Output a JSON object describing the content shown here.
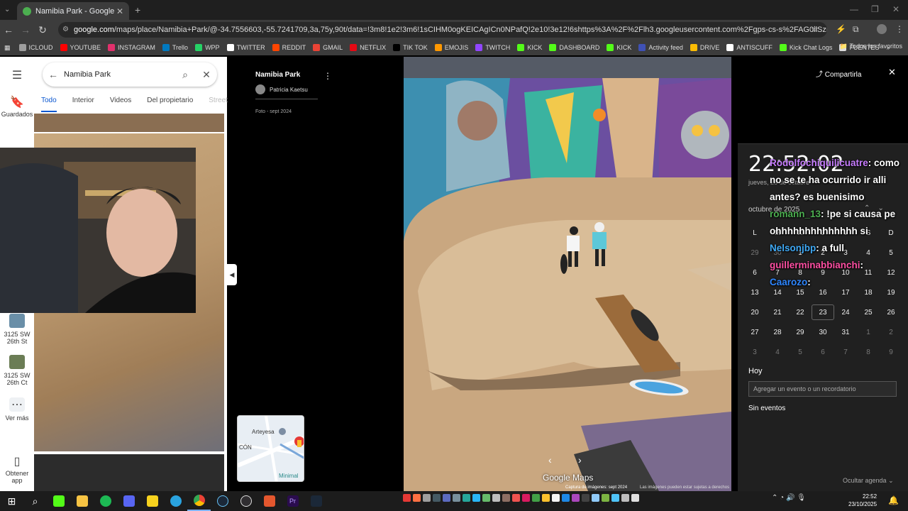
{
  "browser": {
    "tab_title": "Namibia Park - Google Maps",
    "url_host": "google.com",
    "url_rest": "/maps/place/Namibia+Park/@-34.7556603,-55.7241709,3a,75y,90t/data=!3m8!1e2!3m6!1sCIHM0ogKEICAgICn0NPafQ!2e10!3e12!6shttps%3A%2F%2Flh3.googleusercontent.com%2Fgps-cs-s%2FAG0ilSzLO_45bIbOw9xZqQwe5sg_tLDGi9...",
    "bookmarks": [
      {
        "label": "ICLOUD",
        "color": "#9e9e9e"
      },
      {
        "label": "YOUTUBE",
        "color": "#ff0000"
      },
      {
        "label": "INSTAGRAM",
        "color": "#e1306c"
      },
      {
        "label": "Trello",
        "color": "#0079bf"
      },
      {
        "label": "WPP",
        "color": "#25d366"
      },
      {
        "label": "TWITTER",
        "color": "#ffffff"
      },
      {
        "label": "REDDIT",
        "color": "#ff4500"
      },
      {
        "label": "GMAIL",
        "color": "#ea4335"
      },
      {
        "label": "NETFLIX",
        "color": "#e50914"
      },
      {
        "label": "TIK TOK",
        "color": "#000000"
      },
      {
        "label": "EMOJIS",
        "color": "#ff9800"
      },
      {
        "label": "TWITCH",
        "color": "#9146ff"
      },
      {
        "label": "KICK",
        "color": "#53fc18"
      },
      {
        "label": "DASHBOARD",
        "color": "#53fc18"
      },
      {
        "label": "KICK",
        "color": "#53fc18"
      },
      {
        "label": "Activity feed",
        "color": "#3f51b5"
      },
      {
        "label": "DRIVE",
        "color": "#fbbc04"
      },
      {
        "label": "ANTISCUFF",
        "color": "#ffffff"
      },
      {
        "label": "Kick Chat Logs",
        "color": "#53fc18"
      },
      {
        "label": "FUENTES",
        "color": "#dddddd"
      }
    ],
    "bookmarks_more": "»",
    "all_bookmarks": "Todos los favoritos"
  },
  "maps": {
    "rail": {
      "saved": "Guardados",
      "place1": "3125 SW 26th St",
      "place2": "3125 SW 26th Ct",
      "more": "Ver más",
      "get_app": "Obtener app"
    },
    "search_value": "Namibia Park",
    "tabs": [
      "Todo",
      "Interior",
      "Videos",
      "Del propietario",
      "Street"
    ],
    "viewer": {
      "title": "Namibia Park",
      "author": "Patricia Kaetsu",
      "date": "Foto - sept 2024",
      "share": "Compartirla",
      "watermark": "Google Maps",
      "capture": "Captura de imágenes: sept 2024",
      "rights": "Las imágenes pueden estar sujetas a derechos"
    },
    "minimap_labels": [
      "Arteyesa",
      "CÓN",
      "Minimal"
    ]
  },
  "calendar": {
    "time": "22:52:02",
    "date_line": "jueves, 23 de octubre",
    "month": "octubre de 2025",
    "weekdays": [
      "L",
      "M",
      "X",
      "J",
      "V",
      "S",
      "D"
    ],
    "weeks": [
      [
        "29",
        "30",
        "1",
        "2",
        "3",
        "4",
        "5"
      ],
      [
        "6",
        "7",
        "8",
        "9",
        "10",
        "11",
        "12"
      ],
      [
        "13",
        "14",
        "15",
        "16",
        "17",
        "18",
        "19"
      ],
      [
        "20",
        "21",
        "22",
        "23",
        "24",
        "25",
        "26"
      ],
      [
        "27",
        "28",
        "29",
        "30",
        "31",
        "1",
        "2"
      ],
      [
        "3",
        "4",
        "5",
        "6",
        "7",
        "8",
        "9"
      ]
    ],
    "today_label": "Hoy",
    "add_placeholder": "Agregar un evento o un recordatorio",
    "no_events": "Sin eventos",
    "hide_agenda": "Ocultar agenda"
  },
  "chat": [
    {
      "user": "Rodolfochiquilicuatre",
      "color": "#c77dff",
      "text": "como no se te ha ocurrido ir alli antes? es buenisimo"
    },
    {
      "user": "romann_13",
      "color": "#4caf50",
      "text": "!pe si causa pe ohhhhhhhhhhhhhh si"
    },
    {
      "user": "Nelsonjbp",
      "color": "#3fa9f5",
      "text": "a full"
    },
    {
      "user": "guillerminabbianchi",
      "color": "#ff4fa3",
      "text": ""
    },
    {
      "user": "Caarozo",
      "color": "#2e86ff",
      "text": ""
    }
  ],
  "taskbar": {
    "time": "22:52",
    "date": "23/10/2025"
  }
}
